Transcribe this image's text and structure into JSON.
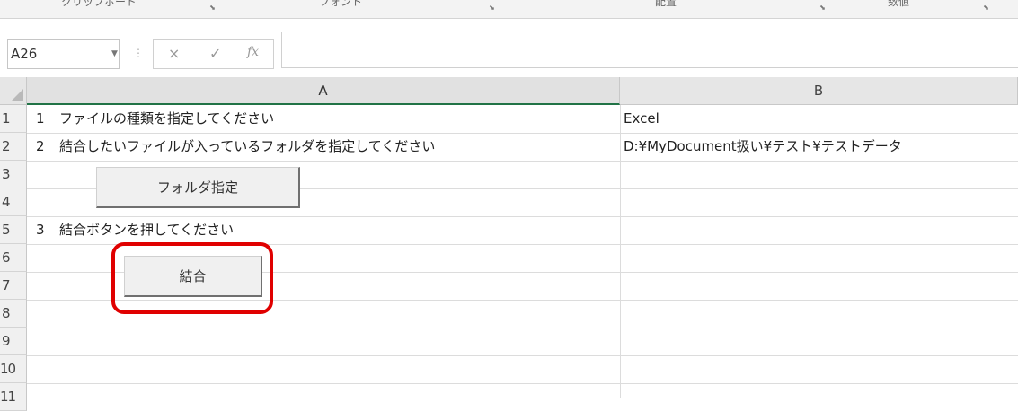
{
  "ribbon": {
    "groups": [
      "クリップボード",
      "フォント",
      "配置",
      "数値"
    ]
  },
  "formula_bar": {
    "name_box": "A26",
    "cancel_icon": "×",
    "enter_icon": "✓",
    "function_icon": "fx",
    "content": ""
  },
  "sheet": {
    "columns": [
      "A",
      "B"
    ],
    "rows": [
      "1",
      "2",
      "3",
      "4",
      "5",
      "6",
      "7",
      "8",
      "9",
      "10",
      "11"
    ],
    "cells": {
      "r1_num": "1",
      "r1_text": "ファイルの種類を指定してください",
      "r1_b": "Excel",
      "r2_num": "2",
      "r2_text": "結合したいファイルが入っているフォルダを指定してください",
      "r2_b": "D:¥MyDocument扱い¥テスト¥テストデータ",
      "r5_num": "3",
      "r5_text": "結合ボタンを押してください"
    }
  },
  "buttons": {
    "folder": "フォルダ指定",
    "merge": "結合"
  },
  "colors": {
    "highlight": "#e00000",
    "active_header_accent": "#217346"
  }
}
